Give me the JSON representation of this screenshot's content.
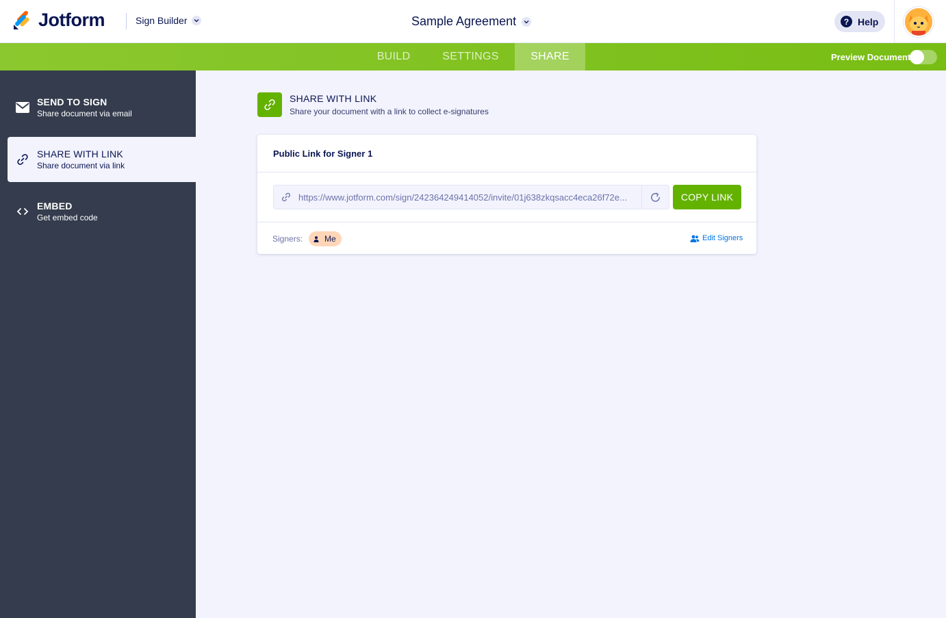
{
  "header": {
    "brand": "Jotform",
    "product": "Sign Builder",
    "document_title": "Sample Agreement",
    "help_label": "Help"
  },
  "nav": {
    "tabs": [
      {
        "label": "BUILD",
        "active": false
      },
      {
        "label": "SETTINGS",
        "active": false
      },
      {
        "label": "SHARE",
        "active": true
      }
    ],
    "preview_label": "Preview Document",
    "preview_enabled": false
  },
  "sidebar": {
    "items": [
      {
        "title": "SEND TO SIGN",
        "subtitle": "Share document via email",
        "icon": "envelope-icon",
        "active": false
      },
      {
        "title": "SHARE WITH LINK",
        "subtitle": "Share document via link",
        "icon": "link-icon",
        "active": true
      },
      {
        "title": "EMBED",
        "subtitle": "Get embed code",
        "icon": "code-icon",
        "active": false
      }
    ]
  },
  "section": {
    "title": "SHARE WITH LINK",
    "subtitle": "Share your document with a link to collect e-signatures",
    "icon": "link-icon"
  },
  "card": {
    "title": "Public Link for Signer 1",
    "url": "https://www.jotform.com/sign/242364249414052/invite/01j638zkqsacc4eca26f72e...",
    "copy_label": "COPY LINK",
    "signers_label": "Signers:",
    "signer_chip": "Me",
    "edit_signers_label": "Edit Signers"
  },
  "colors": {
    "brand_green": "#64b200",
    "nav_green": "#78bd14",
    "sidebar_bg": "#343c4d",
    "navy_text": "#0a1551",
    "link_blue": "#0075e3",
    "chip_bg": "#ffd6b8"
  }
}
